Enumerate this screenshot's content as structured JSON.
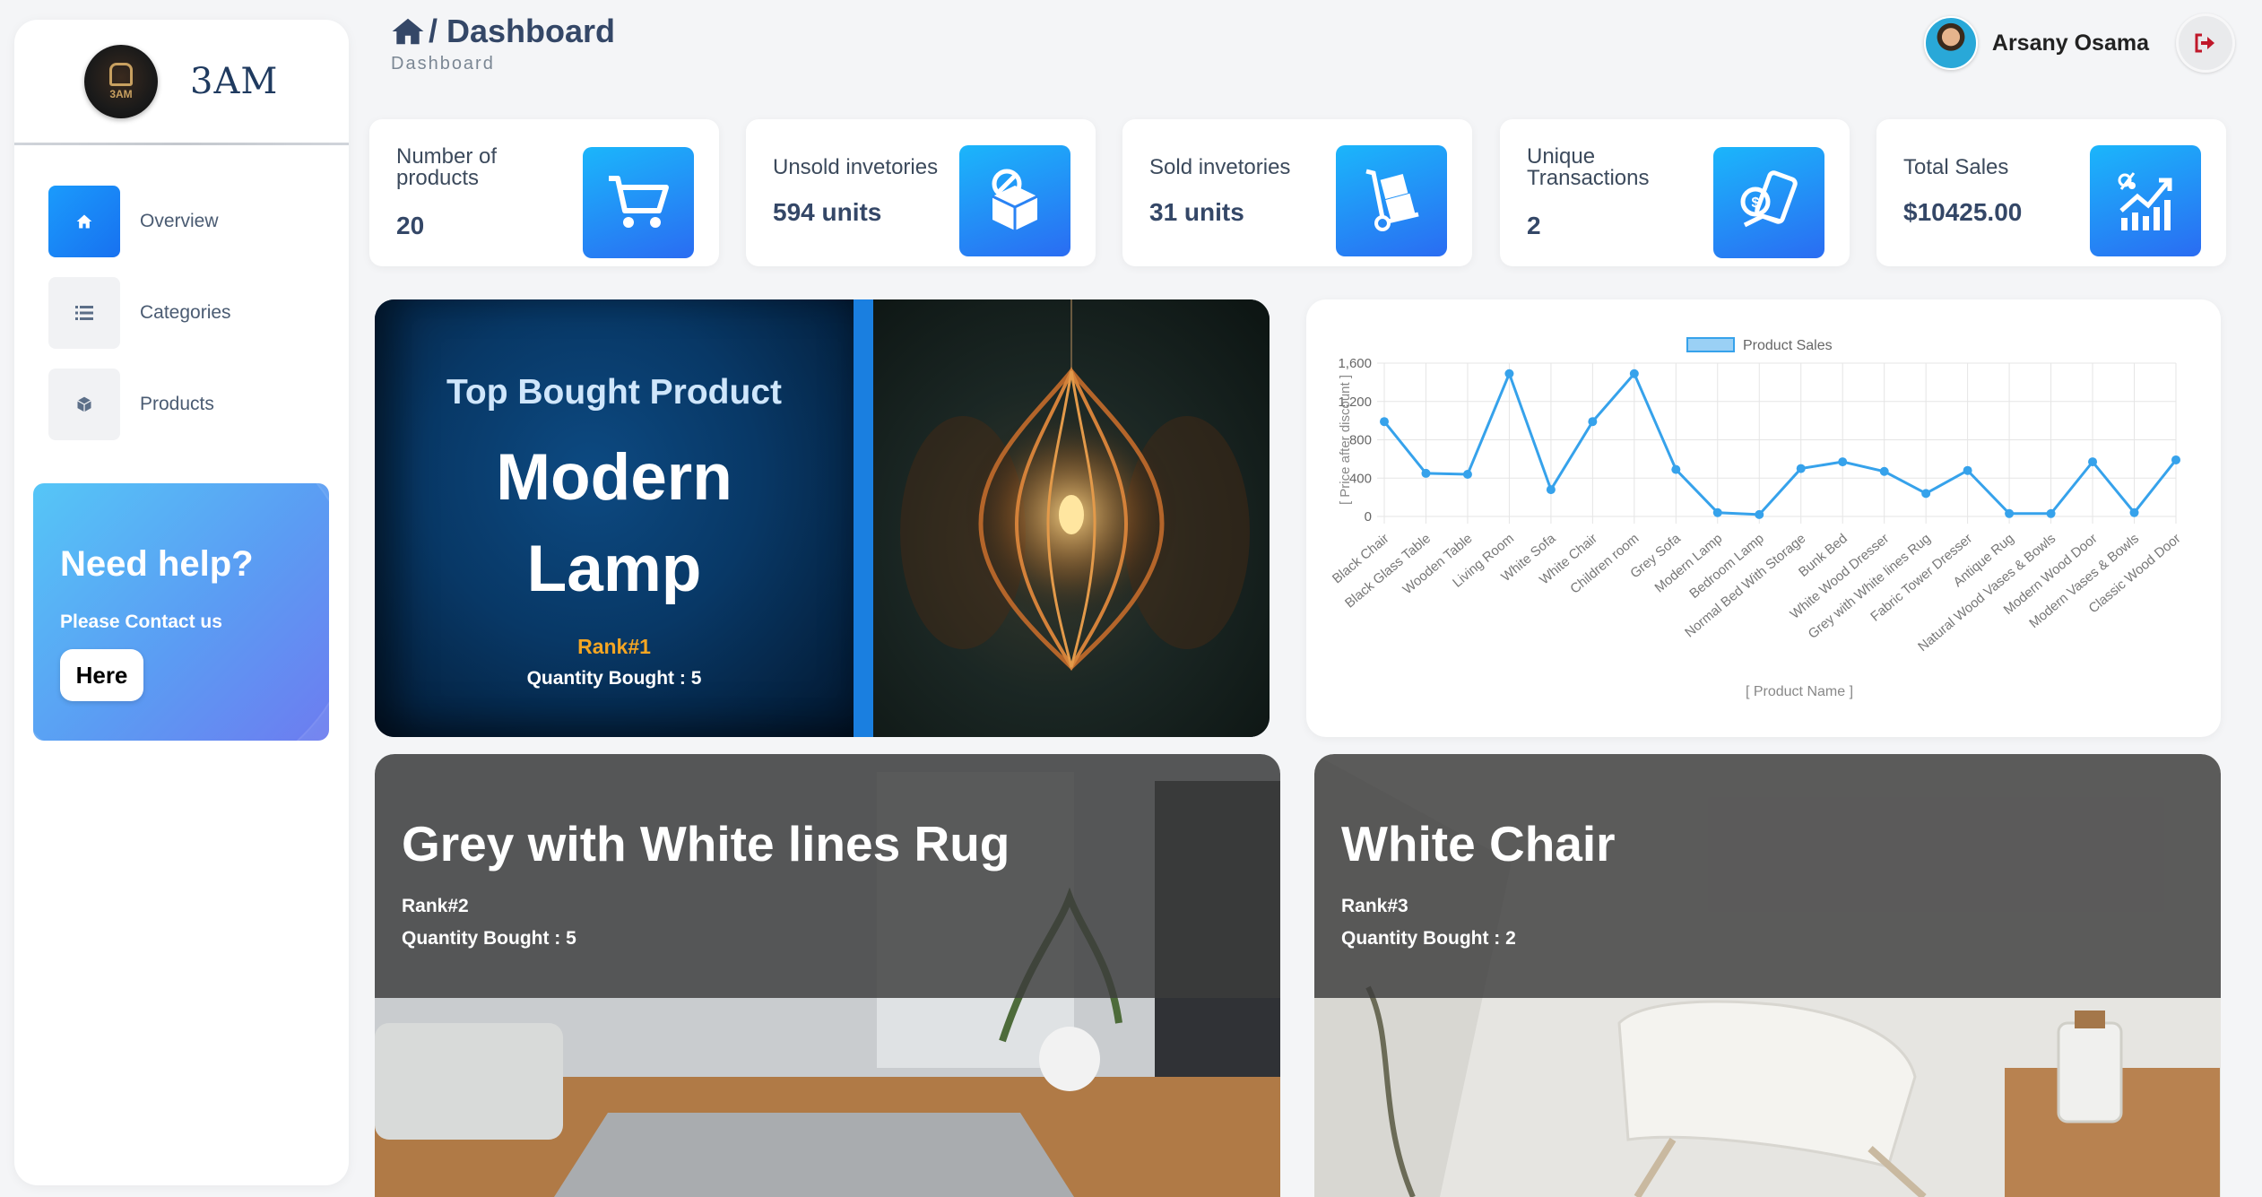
{
  "brand": {
    "name": "3AM",
    "logo_text": "3AM"
  },
  "sidebar": {
    "items": [
      {
        "label": "Overview",
        "icon": "home-icon",
        "active": true
      },
      {
        "label": "Categories",
        "icon": "list-icon",
        "active": false
      },
      {
        "label": "Products",
        "icon": "box-icon",
        "active": false
      }
    ]
  },
  "help": {
    "title": "Need help?",
    "subtitle": "Please Contact us",
    "button": "Here"
  },
  "header": {
    "title": "/ Dashboard",
    "subtitle": "Dashboard"
  },
  "user": {
    "name": "Arsany Osama"
  },
  "stats": [
    {
      "label": "Number of products",
      "value": "20",
      "icon": "cart-icon"
    },
    {
      "label": "Unsold invetories",
      "value": "594 units",
      "icon": "package-icon"
    },
    {
      "label": "Sold invetories",
      "value": "31 units",
      "icon": "hand-truck-icon"
    },
    {
      "label": "Unique Transactions",
      "value": "2",
      "icon": "payment-icon"
    },
    {
      "label": "Total Sales",
      "value": "$10425.00",
      "icon": "growth-chart-icon"
    }
  ],
  "hero": {
    "kicker": "Top Bought Product",
    "name_line1": "Modern",
    "name_line2": "Lamp",
    "rank": "Rank#1",
    "quantity": "Quantity Bought : 5"
  },
  "rank_cards": [
    {
      "title": "Grey with White lines Rug",
      "rank": "Rank#2",
      "quantity": "Quantity Bought : 5"
    },
    {
      "title": "White Chair",
      "rank": "Rank#3",
      "quantity": "Quantity Bought : 2"
    }
  ],
  "colors": {
    "accent": "#1a7fe0",
    "rank_gold": "#f5a623",
    "chart_line": "#36a2eb"
  },
  "chart_data": {
    "type": "line",
    "legend": "Product Sales",
    "legend_position": "top",
    "xlabel": "[ Product Name ]",
    "ylabel": "[ Price after discount ]",
    "ylim": [
      0,
      1600
    ],
    "yticks": [
      "0",
      "400",
      "800",
      "1,200",
      "1,600"
    ],
    "grid": true,
    "categories": [
      "Black Chair",
      "Black Glass Table",
      "Wooden Table",
      "Living Room",
      "White Sofa",
      "White Chair",
      "Children room",
      "Grey Sofa",
      "Modern Lamp",
      "Bedroom Lamp",
      "Normal Bed With Storage",
      "Bunk Bed",
      "White Wood Dresser",
      "Grey with White lines Rug",
      "Fabric Tower Dresser",
      "Antique Rug",
      "Natural Wood Vases & Bowls",
      "Modern Wood Door",
      "Modern Vases & Bowls",
      "Classic Wood Door"
    ],
    "series": [
      {
        "name": "Product Sales",
        "values": [
          990,
          450,
          440,
          1490,
          280,
          990,
          1490,
          490,
          40,
          20,
          500,
          570,
          470,
          240,
          480,
          30,
          30,
          570,
          40,
          590
        ]
      }
    ]
  }
}
